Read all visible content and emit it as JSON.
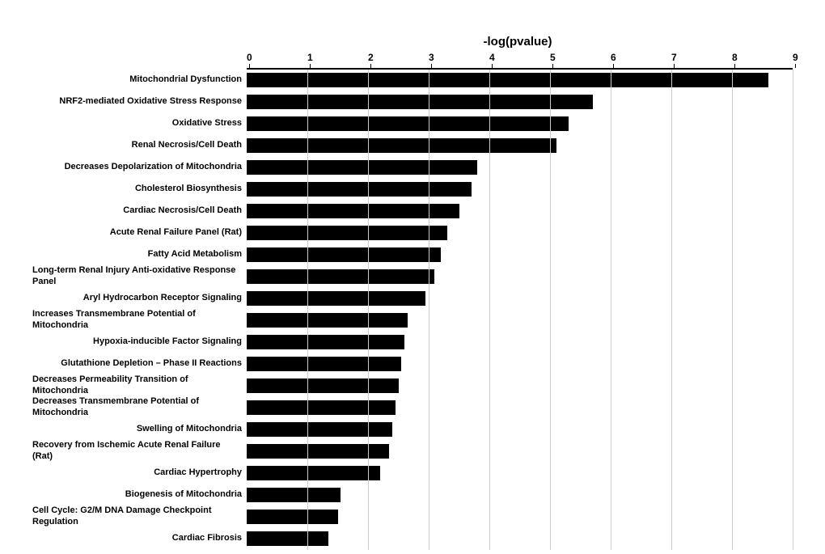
{
  "chart": {
    "title": "-log(pvalue)",
    "x_axis": {
      "ticks": [
        0,
        1,
        2,
        3,
        4,
        5,
        6,
        7,
        8,
        9
      ],
      "max": 9
    },
    "bars": [
      {
        "label": "Mitochondrial Dysfunction",
        "value": 8.6
      },
      {
        "label": "NRF2-mediated Oxidative Stress Response",
        "value": 5.7
      },
      {
        "label": "Oxidative Stress",
        "value": 5.3
      },
      {
        "label": "Renal Necrosis/Cell Death",
        "value": 5.1
      },
      {
        "label": "Decreases Depolarization of Mitochondria",
        "value": 3.8
      },
      {
        "label": "Cholesterol Biosynthesis",
        "value": 3.7
      },
      {
        "label": "Cardiac Necrosis/Cell Death",
        "value": 3.5
      },
      {
        "label": "Acute Renal Failure Panel (Rat)",
        "value": 3.3
      },
      {
        "label": "Fatty Acid Metabolism",
        "value": 3.2
      },
      {
        "label": "Long-term Renal Injury Anti-oxidative Response Panel",
        "value": 3.1
      },
      {
        "label": "Aryl Hydrocarbon Receptor Signaling",
        "value": 2.95
      },
      {
        "label": "Increases Transmembrane Potential of Mitochondria",
        "value": 2.65
      },
      {
        "label": "Hypoxia-inducible Factor Signaling",
        "value": 2.6
      },
      {
        "label": "Glutathione Depletion – Phase II Reactions",
        "value": 2.55
      },
      {
        "label": "Decreases Permeability Transition of Mitochondria",
        "value": 2.5
      },
      {
        "label": "Decreases Transmembrane Potential of Mitochondria",
        "value": 2.45
      },
      {
        "label": "Swelling of Mitochondria",
        "value": 2.4
      },
      {
        "label": "Recovery from Ischemic Acute Renal Failure (Rat)",
        "value": 2.35
      },
      {
        "label": "Cardiac Hypertrophy",
        "value": 2.2
      },
      {
        "label": "Biogenesis of Mitochondria",
        "value": 1.55
      },
      {
        "label": "Cell Cycle: G2/M DNA Damage Checkpoint Regulation",
        "value": 1.5
      },
      {
        "label": "Cardiac Fibrosis",
        "value": 1.35
      }
    ]
  }
}
